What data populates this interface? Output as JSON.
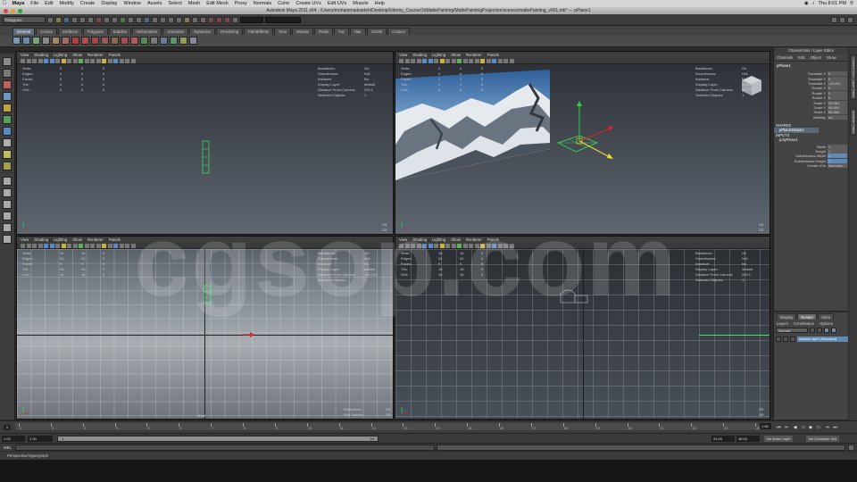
{
  "menubar": {
    "app": "Maya",
    "items": [
      "File",
      "Edit",
      "Modify",
      "Create",
      "Display",
      "Window",
      "Assets",
      "Select",
      "Mesh",
      "Edit Mesh",
      "Proxy",
      "Normals",
      "Color",
      "Create UVs",
      "Edit UVs",
      "Muscle",
      "Help"
    ],
    "clock": "Thu 8:01 PM"
  },
  "window": {
    "title": "Autodesk Maya 2011 x64 - /Users/mohammadsadeh/Desktop/Udemy_Course/3dMattePainting/MattePaintingProjection/scenes/mattePainting_v001.mb* --- pPlane1"
  },
  "statusline": {
    "mode": "Polygons"
  },
  "shelf": {
    "tabs": [
      "General",
      "Curves",
      "Surfaces",
      "Polygons",
      "Subdivs",
      "Deformation",
      "Animation",
      "Dynamics",
      "Rendering",
      "PaintEffects",
      "Toon",
      "Muscle",
      "Fluids",
      "Fur",
      "Hair",
      "nCloth",
      "Custom"
    ],
    "active": "General"
  },
  "viewport_menu": [
    "View",
    "Shading",
    "Lighting",
    "Show",
    "Renderer",
    "Panels"
  ],
  "hud": {
    "labels": [
      "Verts:",
      "Edges:",
      "Faces:",
      "Tris:",
      "UVs:"
    ],
    "right_labels": [
      "Backfaces:",
      "Smoothness:",
      "Instance:",
      "Display Layer:",
      "Distance From Camera:",
      "Selected Objects:"
    ],
    "tl": {
      "values": [
        [
          "0",
          "0",
          "0"
        ],
        [
          "0",
          "0",
          "0"
        ],
        [
          "0",
          "0",
          "0"
        ],
        [
          "0",
          "0",
          "0"
        ],
        [
          "0",
          "0",
          "0"
        ]
      ],
      "right": [
        "On",
        "N/A",
        "No",
        "default",
        "200.1",
        "1"
      ]
    },
    "tr": {
      "values": [
        [
          "4",
          "4",
          "0"
        ],
        [
          "4",
          "4",
          "0"
        ],
        [
          "1",
          "1",
          "0"
        ],
        [
          "2",
          "2",
          "0"
        ],
        [
          "4",
          "4",
          "0"
        ]
      ],
      "right": [
        "On",
        "N/A",
        "No",
        "default",
        "850.378",
        "1"
      ]
    },
    "bl": {
      "values": [
        [
          "16",
          "16",
          "0"
        ],
        [
          "24",
          "24",
          "0"
        ],
        [
          "9",
          "9",
          "0"
        ],
        [
          "18",
          "18",
          "0"
        ],
        [
          "16",
          "16",
          "0"
        ]
      ],
      "right": [
        "On",
        "N/A",
        "No",
        "default",
        "194.153",
        "1"
      ]
    },
    "br": {
      "values": [
        [
          "16",
          "16",
          "0"
        ],
        [
          "24",
          "24",
          "0"
        ],
        [
          "9",
          "9",
          "0"
        ],
        [
          "18",
          "18",
          "0"
        ],
        [
          "16",
          "16",
          "0"
        ]
      ],
      "right": [
        "On",
        "N/A",
        "No",
        "default",
        "200.1",
        "1"
      ]
    },
    "bottom_tl": [
      "Off",
      "Off"
    ],
    "bottom_tr": [
      "Off",
      "Off"
    ],
    "bottom_bl": [
      [
        "Reflections:",
        "Off"
      ],
      [
        "Soft Selects:",
        "Off"
      ]
    ],
    "bottom_br": [
      "Off",
      "Off"
    ],
    "cam_label_bl": "front"
  },
  "watermark": "cgsop.com",
  "channelbox": {
    "title": "Channel Box / Layer Editor",
    "menu": [
      "Channels",
      "Edit",
      "Object",
      "Show"
    ],
    "object": "pPlane1",
    "attrs": [
      {
        "k": "Translate X",
        "v": "0"
      },
      {
        "k": "Translate Y",
        "v": "0"
      },
      {
        "k": "Translate Z",
        "v": "-44.000"
      },
      {
        "k": "Rotate X",
        "v": "0"
      },
      {
        "k": "Rotate Y",
        "v": "0"
      },
      {
        "k": "Rotate Z",
        "v": "0"
      },
      {
        "k": "Scale X",
        "v": "96.854"
      },
      {
        "k": "Scale Y",
        "v": "96.854"
      },
      {
        "k": "Scale Z",
        "v": "96.854"
      },
      {
        "k": "Visibility",
        "v": "on"
      }
    ],
    "shapes_label": "SHAPES",
    "shape_name": "pPlaneShape1",
    "inputs_label": "INPUTS",
    "input_name": "polyPlane1",
    "input_attrs": [
      {
        "k": "Width",
        "v": "1"
      },
      {
        "k": "Height",
        "v": "1"
      },
      {
        "k": "Subdivisions Width",
        "v": "1"
      },
      {
        "k": "Subdivisions Height",
        "v": "1"
      },
      {
        "k": "Create UVs",
        "v": "Normaliz..."
      }
    ]
  },
  "vtabs": [
    "Channel Box / Layer Editor",
    "Attribute Editor"
  ],
  "layereditor": {
    "tabs": [
      "Display",
      "Render",
      "Anim"
    ],
    "active": "Render",
    "menu": [
      "Layers",
      "Contribution",
      "Options"
    ],
    "blend": "Normal",
    "layer_name": "masterLayer (Standard)"
  },
  "timeline": {
    "ticks": [
      "1",
      "2",
      "3",
      "4",
      "5",
      "6",
      "7",
      "8",
      "9",
      "10",
      "11",
      "12",
      "13",
      "14",
      "15",
      "16",
      "17",
      "18",
      "19",
      "20",
      "21",
      "22",
      "23",
      "24"
    ],
    "current": "1",
    "current_field": "1.00"
  },
  "range": {
    "start": "1.00",
    "inner_start": "1.00",
    "range_left": "1",
    "range_right": "24",
    "end": "24.00",
    "end_total": "48.00",
    "anim_layer": "No Anim Layer",
    "character": "No Character Set"
  },
  "cmdline": {
    "label": "MEL"
  },
  "helpline": {
    "text": "Perspective/Hypergraph"
  },
  "colors": {
    "manip_x": "#d22a2a",
    "manip_y": "#2ad24a",
    "manip_z": "#f0e030",
    "selected": "#3ae860"
  }
}
